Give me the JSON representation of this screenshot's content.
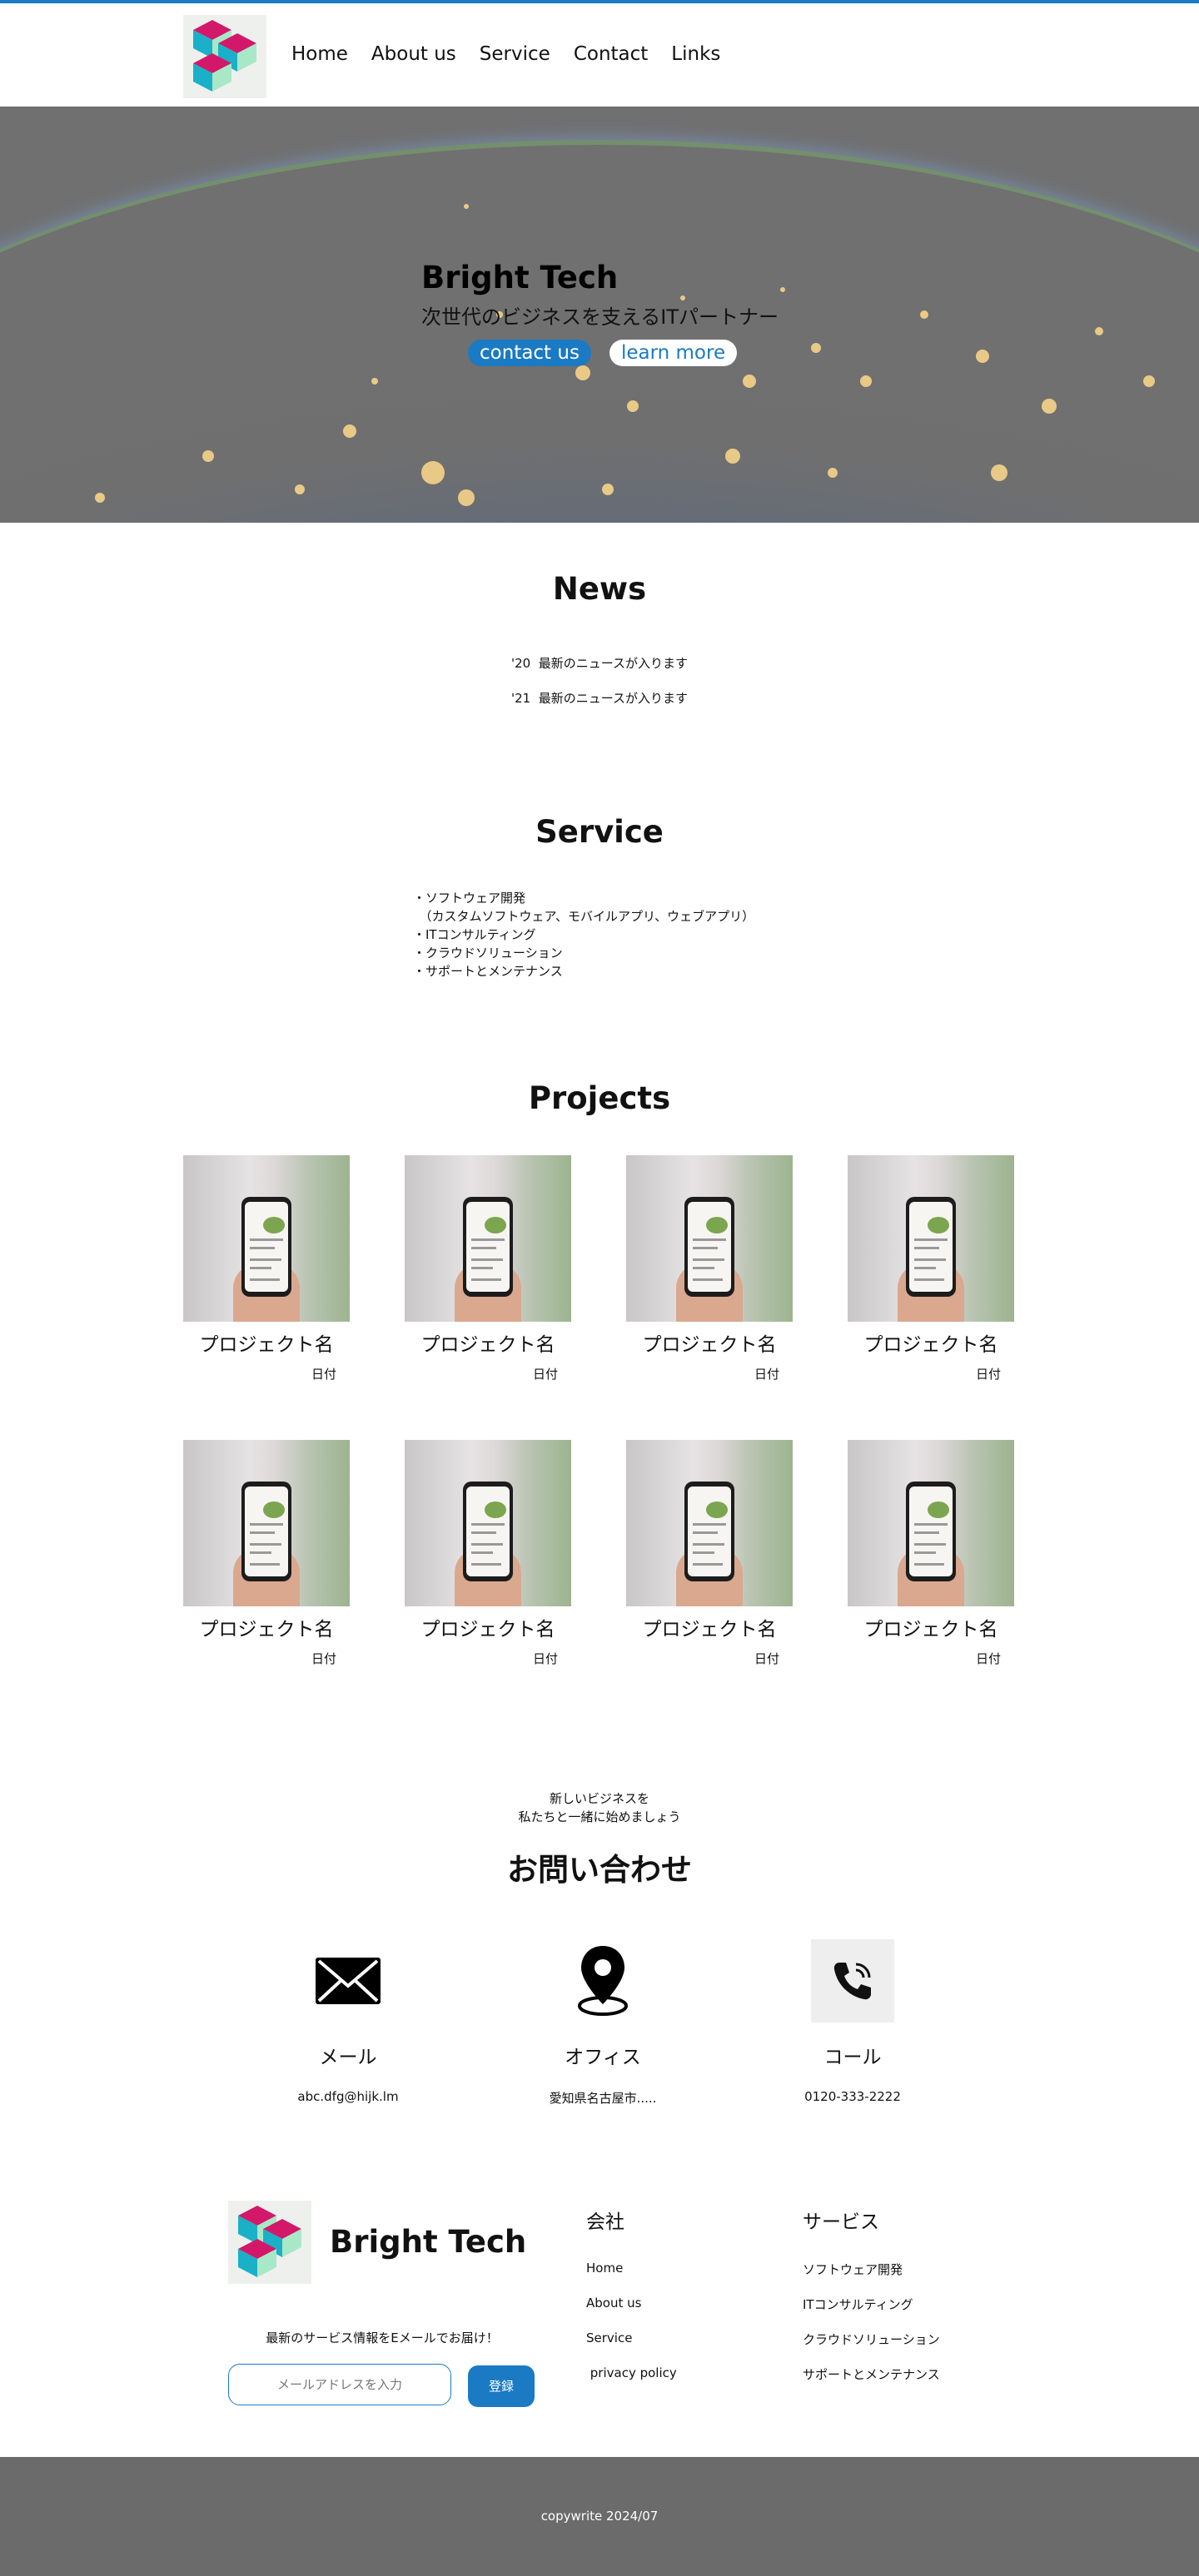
{
  "brand": {
    "name": "Bright Tech"
  },
  "nav": {
    "items": [
      "Home",
      "About us",
      "Service",
      "Contact",
      "Links"
    ]
  },
  "hero": {
    "title": "Bright Tech",
    "subtitle": "次世代のビジネスを支えるITパートナー",
    "primary_button": "contact us",
    "secondary_button": "learn more"
  },
  "news": {
    "heading": "News",
    "items": [
      {
        "year": "'20",
        "text": "最新のニュースが入ります"
      },
      {
        "year": "'21",
        "text": "最新のニュースが入ります"
      }
    ]
  },
  "service": {
    "heading": "Service",
    "items": [
      "・ソフトウェア開発",
      "　（カスタムソフトウェア、モバイルアプリ、ウェブアプリ）",
      "・ITコンサルティング",
      "・クラウドソリューション",
      "・サポートとメンテナンス"
    ]
  },
  "projects": {
    "heading": "Projects",
    "items": [
      {
        "name": "プロジェクト名",
        "date": "日付"
      },
      {
        "name": "プロジェクト名",
        "date": "日付"
      },
      {
        "name": "プロジェクト名",
        "date": "日付"
      },
      {
        "name": "プロジェクト名",
        "date": "日付"
      },
      {
        "name": "プロジェクト名",
        "date": "日付"
      },
      {
        "name": "プロジェクト名",
        "date": "日付"
      },
      {
        "name": "プロジェクト名",
        "date": "日付"
      },
      {
        "name": "プロジェクト名",
        "date": "日付"
      }
    ]
  },
  "contact": {
    "tagline_1": "新しいビジネスを",
    "tagline_2": "私たちと一緒に始めましょう",
    "heading": "お問い合わせ",
    "items": [
      {
        "icon": "envelope-icon",
        "label": "メール",
        "value": "abc.dfg@hijk.lm"
      },
      {
        "icon": "location-pin-icon",
        "label": "オフィス",
        "value": "愛知県名古屋市....."
      },
      {
        "icon": "phone-icon",
        "label": "コール",
        "value": "0120-333-2222"
      }
    ]
  },
  "footer": {
    "brand": "Bright Tech",
    "newsletter_text": "最新のサービス情報をEメールでお届け！",
    "email_placeholder": "メールアドレスを入力",
    "submit_label": "登録",
    "company": {
      "heading": "会社",
      "links": [
        "Home",
        "About us",
        "Service",
        " privacy policy"
      ]
    },
    "services": {
      "heading": "サービス",
      "links": [
        "ソフトウェア開発",
        "ITコンサルティング",
        "クラウドソリューション",
        "サポートとメンテナンス"
      ]
    },
    "copyright": "copywrite 2024/07"
  },
  "colors": {
    "accent": "#1a7ac4",
    "footer_bg": "#6b6b6b",
    "logo_pink": "#d3186a",
    "logo_teal": "#1ab0c7",
    "logo_mint": "#a8e8c7"
  }
}
